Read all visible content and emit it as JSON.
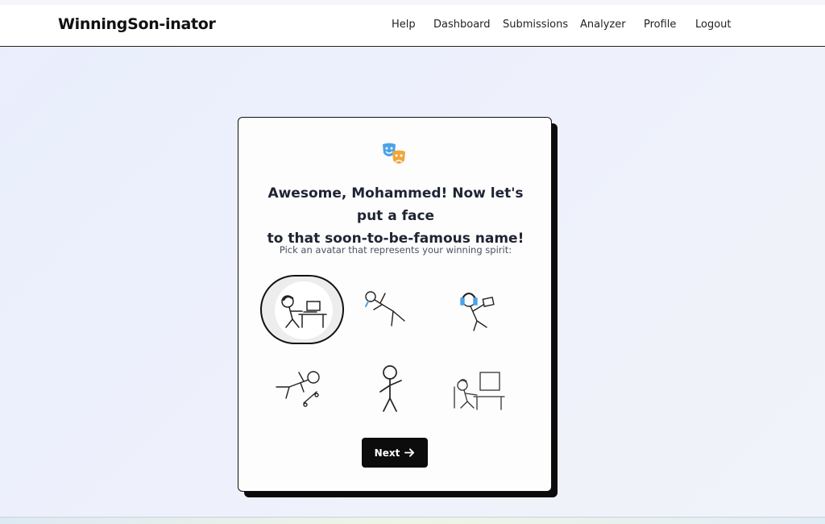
{
  "navbar": {
    "brand": "WinningSon-inator",
    "links": [
      {
        "label": "Help"
      },
      {
        "label": "Dashboard"
      },
      {
        "label": "Submissions"
      },
      {
        "label": "Analyzer"
      },
      {
        "label": "Profile"
      },
      {
        "label": "Logout"
      }
    ]
  },
  "card": {
    "icon": "theater-masks-icon",
    "title_line1": "Awesome, Mohammed! Now let's put a face",
    "title_line2": "to that soon-to-be-famous name!",
    "subtitle": "Pick an avatar that represents your winning spirit:",
    "avatars": [
      {
        "icon": "stickman-at-desk-icon",
        "selected": true
      },
      {
        "icon": "stickman-falling-icon",
        "selected": false
      },
      {
        "icon": "stickman-headphones-icon",
        "selected": false
      },
      {
        "icon": "stickman-skateboard-icon",
        "selected": false
      },
      {
        "icon": "stickman-standing-icon",
        "selected": false
      },
      {
        "icon": "stickman-computer-icon",
        "selected": false
      }
    ],
    "next_label": "Next"
  },
  "colors": {
    "mask_blue": "#4aa3e8",
    "mask_orange": "#f0a63c",
    "button": "#0c0c0c"
  }
}
